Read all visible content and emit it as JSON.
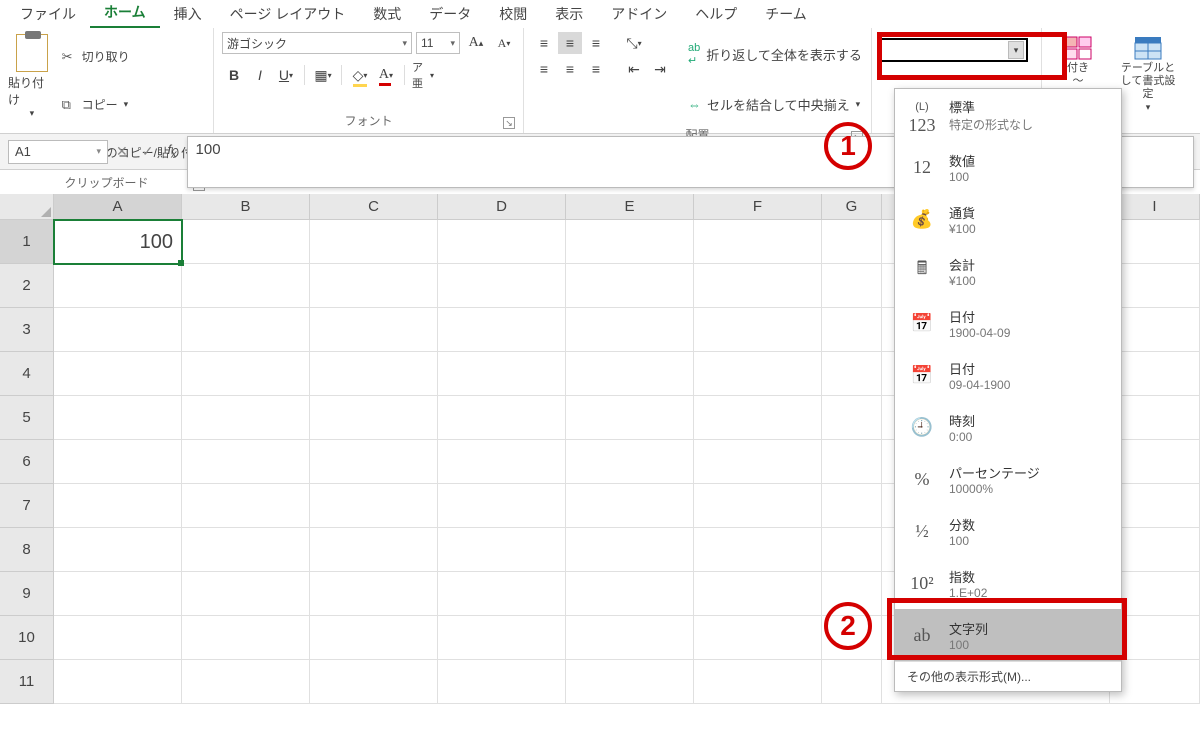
{
  "menu": {
    "items": [
      "ファイル",
      "ホーム",
      "挿入",
      "ページ レイアウト",
      "数式",
      "データ",
      "校閲",
      "表示",
      "アドイン",
      "ヘルプ",
      "チーム"
    ],
    "active_index": 1
  },
  "ribbon": {
    "clipboard": {
      "paste": "貼り付け",
      "cut": "切り取り",
      "copy": "コピー",
      "format_painter": "書式のコピー/貼り付け",
      "label": "クリップボード"
    },
    "font": {
      "name": "游ゴシック",
      "size": "11",
      "label": "フォント"
    },
    "alignment": {
      "wrap": "折り返して全体を表示する",
      "merge": "セルを結合して中央揃え",
      "label": "配置"
    },
    "styles": {
      "cond": "条件付き書式",
      "table": "テーブルとして書式設定",
      "suffix": "付き",
      "suffix2": "～"
    }
  },
  "formula_bar": {
    "name_box": "A1",
    "value": "100"
  },
  "grid": {
    "columns": [
      "A",
      "B",
      "C",
      "D",
      "E",
      "F",
      "G",
      "",
      "I"
    ],
    "rows": [
      "1",
      "2",
      "3",
      "4",
      "5",
      "6",
      "7",
      "8",
      "9",
      "10",
      "11"
    ],
    "active_cell_value": "100"
  },
  "number_format_menu": {
    "items": [
      {
        "icon": "123",
        "title": "標準",
        "sub": "特定の形式なし"
      },
      {
        "icon": "12",
        "title": "数値",
        "sub": "100"
      },
      {
        "icon": "coins",
        "title": "通貨",
        "sub": "¥100"
      },
      {
        "icon": "calc",
        "title": "会計",
        "sub": "¥100"
      },
      {
        "icon": "cal",
        "title": "日付",
        "sub": "1900-04-09"
      },
      {
        "icon": "cal",
        "title": "日付",
        "sub": "09-04-1900"
      },
      {
        "icon": "clock",
        "title": "時刻",
        "sub": "0:00"
      },
      {
        "icon": "%",
        "title": "パーセンテージ",
        "sub": "10000%"
      },
      {
        "icon": "1/2",
        "title": "分数",
        "sub": "100"
      },
      {
        "icon": "10^2",
        "title": "指数",
        "sub": "1.E+02"
      },
      {
        "icon": "ab",
        "title": "文字列",
        "sub": "100"
      }
    ],
    "more": "その他の表示形式(M)...",
    "highlight_index": 10
  },
  "annotations": {
    "one": "1",
    "two": "2"
  }
}
